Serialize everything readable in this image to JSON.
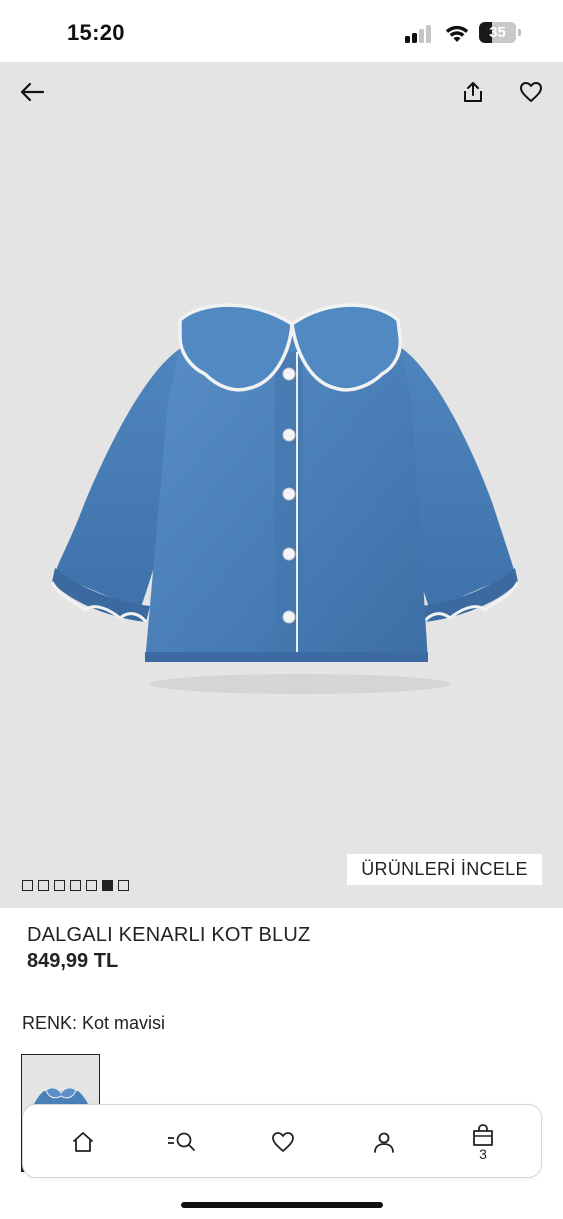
{
  "status_bar": {
    "time": "15:20",
    "battery_level": "35"
  },
  "hero": {
    "back_icon": "arrow-left-icon",
    "share_icon": "share-icon",
    "favorite_icon": "heart-icon",
    "image_alt": "denim blouse with scalloped collar",
    "carousel_total": 7,
    "carousel_active_index": 5,
    "explore_button_label": "ÜRÜNLERİ İNCELE"
  },
  "product": {
    "title": "DALGALI KENARLI KOT BLUZ",
    "price": "849,99 TL",
    "color_label": "RENK: Kot mavisi"
  },
  "bottom_nav": {
    "items": [
      {
        "name": "home",
        "icon": "home-icon"
      },
      {
        "name": "search",
        "icon": "search-icon"
      },
      {
        "name": "favorites",
        "icon": "heart-icon"
      },
      {
        "name": "account",
        "icon": "user-icon"
      },
      {
        "name": "bag",
        "icon": "shopping-bag-icon",
        "badge": "3"
      }
    ]
  },
  "colors": {
    "hero_background": "#e4e4e4",
    "denim": "#4a7fb8",
    "text": "#222222"
  }
}
